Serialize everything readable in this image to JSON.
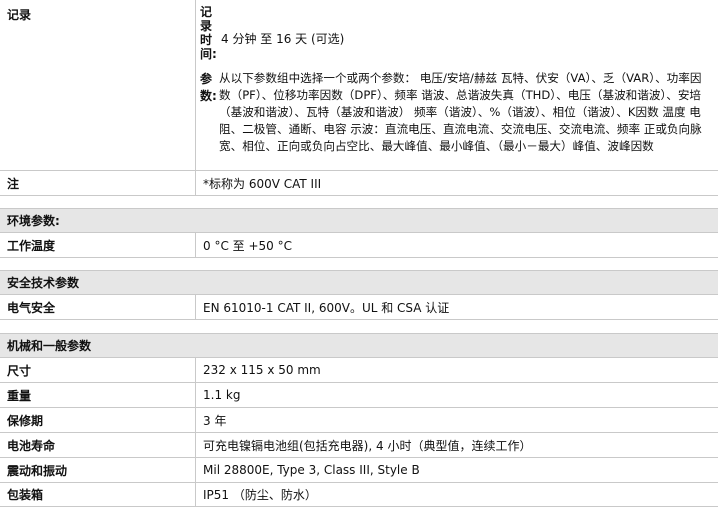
{
  "record": {
    "label": "记录",
    "time_label_chars": [
      "记",
      "录",
      "时",
      "间:"
    ],
    "time_value": "4 分钟 至 16 天 (可选)",
    "params_label_chars": [
      "参",
      "数:"
    ],
    "params_value": "从以下参数组中选择一个或两个参数： 电压/安培/赫兹 瓦特、伏安（VA）、乏（VAR）、功率因数（PF）、位移功率因数（DPF）、频率 谐波、总谐波失真（THD）、电压（基波和谐波）、安培（基波和谐波）、瓦特（基波和谐波） 频率（谐波）、%（谐波）、相位（谐波）、K因数 温度 电阻、二极管、通断、电容 示波：直流电压、直流电流、交流电压、交流电流、频率 正或负向脉宽、相位、正向或负向占空比、最大峰值、最小峰值、（最小－最大）峰值、波峰因数"
  },
  "note": {
    "label": "注",
    "value": "*标称为 600V CAT III"
  },
  "sections": {
    "environment": {
      "title": "环境参数:",
      "rows": [
        {
          "label": "工作温度",
          "value": "0 °C 至 +50 °C"
        }
      ]
    },
    "safety": {
      "title": "安全技术参数",
      "rows": [
        {
          "label": "电气安全",
          "value": "EN 61010-1 CAT II, 600V。UL 和 CSA 认证"
        }
      ]
    },
    "mechanical": {
      "title": "机械和一般参数",
      "rows": [
        {
          "label": "尺寸",
          "value": "232 x 115 x 50 mm"
        },
        {
          "label": "重量",
          "value": "1.1 kg"
        },
        {
          "label": "保修期",
          "value": "3 年"
        },
        {
          "label": "电池寿命",
          "value": "可充电镍镉电池组(包括充电器), 4 小时（典型值，连续工作）"
        },
        {
          "label": "震动和振动",
          "value": "Mil 28800E, Type 3, Class III, Style B"
        },
        {
          "label": "包装箱",
          "value": "IP51 （防尘、防水）"
        }
      ]
    }
  }
}
